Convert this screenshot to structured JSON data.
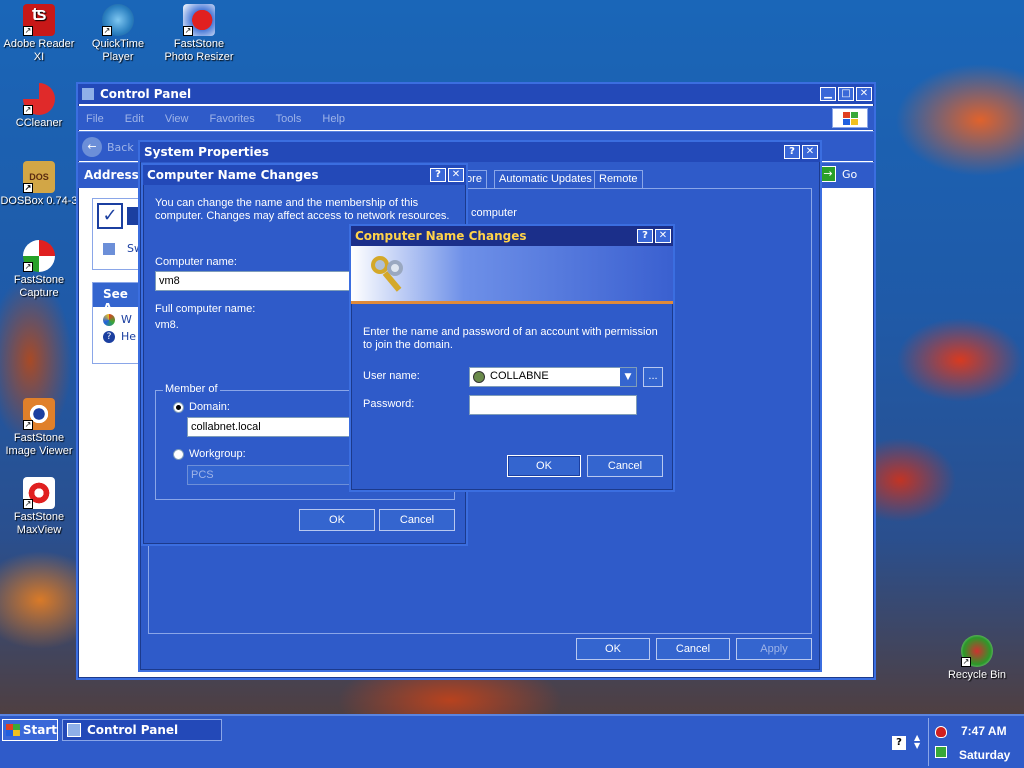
{
  "desktop": {
    "icons": [
      {
        "label": "Adobe Reader XI",
        "icon": "adobe-reader-icon"
      },
      {
        "label": "QuickTime Player",
        "icon": "quicktime-icon"
      },
      {
        "label": "FastStone Photo Resizer",
        "icon": "faststone-photo-resizer-icon"
      },
      {
        "label": "CCleaner",
        "icon": "ccleaner-icon"
      },
      {
        "label": "DOSBox 0.74-3",
        "icon": "dosbox-icon",
        "badge": "DOS"
      },
      {
        "label": "FastStone Capture",
        "icon": "faststone-capture-icon"
      },
      {
        "label": "FastStone Image Viewer",
        "icon": "faststone-image-viewer-icon"
      },
      {
        "label": "FastStone MaxView",
        "icon": "faststone-maxview-icon"
      },
      {
        "label": "Recycle Bin",
        "icon": "recycle-bin-icon"
      }
    ]
  },
  "control_panel": {
    "title": "Control Panel",
    "menu": [
      "File",
      "Edit",
      "View",
      "Favorites",
      "Tools",
      "Help"
    ],
    "back_label": "Back",
    "address_label": "Address",
    "go_label": "Go",
    "side_task_1": "Sw",
    "see_also": "See A",
    "see_also_1": "W",
    "see_also_2": "He"
  },
  "system_properties": {
    "title": "System Properties",
    "tabs": [
      "tore",
      "Automatic Updates",
      "Remote"
    ],
    "body_text": "computer",
    "ok": "OK",
    "cancel": "Cancel",
    "apply": "Apply"
  },
  "name_changes_bg": {
    "title": "Computer Name Changes",
    "intro": "You can change the name and the membership of this computer. Changes may affect access to network resources.",
    "computer_name_label": "Computer name:",
    "computer_name_value": "vm8",
    "full_name_label": "Full computer name:",
    "full_name_value": "vm8.",
    "member_of": "Member of",
    "domain_label": "Domain:",
    "domain_value": "collabnet.local",
    "workgroup_label": "Workgroup:",
    "workgroup_value": "PCS",
    "ok": "OK",
    "cancel": "Cancel"
  },
  "name_changes_fg": {
    "title": "Computer Name Changes",
    "instruction": "Enter the name and password of an account with permission to join the domain.",
    "user_label": "User name:",
    "user_value": "COLLABNE",
    "password_label": "Password:",
    "password_value": "",
    "browse": "...",
    "ok": "OK",
    "cancel": "Cancel"
  },
  "taskbar": {
    "start": "Start",
    "task": "Control Panel",
    "time": "7:47 AM",
    "day": "Saturday"
  },
  "colors": {
    "window_blue": "#2f5bc9",
    "title_blue": "#2349b8",
    "taskbar_blue": "#2f5bc9"
  }
}
